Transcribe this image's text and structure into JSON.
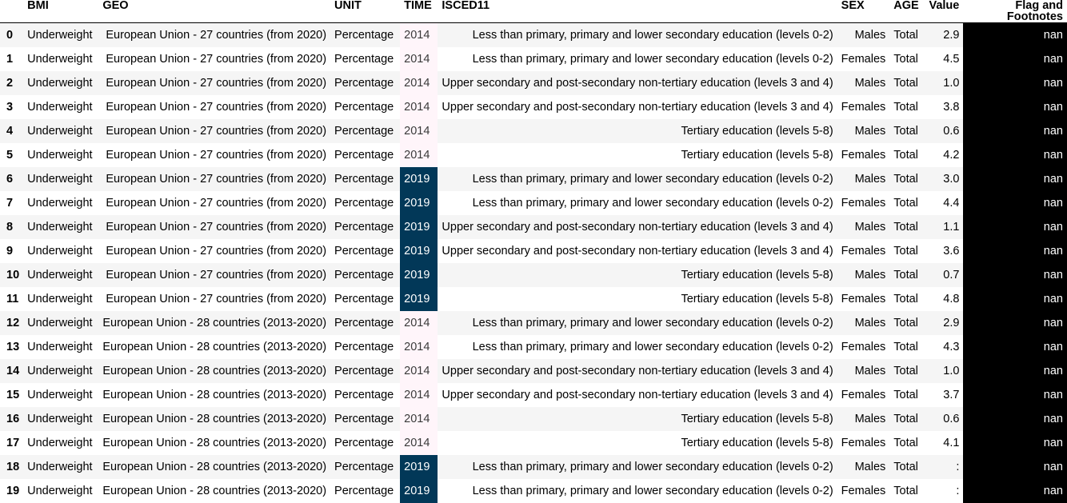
{
  "columns": {
    "index": "",
    "bmi": "BMI",
    "geo": "GEO",
    "unit": "UNIT",
    "time": "TIME",
    "isced": "ISCED11",
    "sex": "SEX",
    "age": "AGE",
    "value": "Value",
    "flag": "Flag and Footnotes"
  },
  "rows": [
    {
      "idx": "0",
      "bmi": "Underweight",
      "geo": "European Union - 27 countries (from 2020)",
      "unit": "Percentage",
      "time": "2014",
      "isced": "Less than primary, primary and lower secondary education (levels 0-2)",
      "sex": "Males",
      "age": "Total",
      "value": "2.9",
      "flag": "nan"
    },
    {
      "idx": "1",
      "bmi": "Underweight",
      "geo": "European Union - 27 countries (from 2020)",
      "unit": "Percentage",
      "time": "2014",
      "isced": "Less than primary, primary and lower secondary education (levels 0-2)",
      "sex": "Females",
      "age": "Total",
      "value": "4.5",
      "flag": "nan"
    },
    {
      "idx": "2",
      "bmi": "Underweight",
      "geo": "European Union - 27 countries (from 2020)",
      "unit": "Percentage",
      "time": "2014",
      "isced": "Upper secondary and post-secondary non-tertiary education (levels 3 and 4)",
      "sex": "Males",
      "age": "Total",
      "value": "1.0",
      "flag": "nan"
    },
    {
      "idx": "3",
      "bmi": "Underweight",
      "geo": "European Union - 27 countries (from 2020)",
      "unit": "Percentage",
      "time": "2014",
      "isced": "Upper secondary and post-secondary non-tertiary education (levels 3 and 4)",
      "sex": "Females",
      "age": "Total",
      "value": "3.8",
      "flag": "nan"
    },
    {
      "idx": "4",
      "bmi": "Underweight",
      "geo": "European Union - 27 countries (from 2020)",
      "unit": "Percentage",
      "time": "2014",
      "isced": "Tertiary education (levels 5-8)",
      "sex": "Males",
      "age": "Total",
      "value": "0.6",
      "flag": "nan"
    },
    {
      "idx": "5",
      "bmi": "Underweight",
      "geo": "European Union - 27 countries (from 2020)",
      "unit": "Percentage",
      "time": "2014",
      "isced": "Tertiary education (levels 5-8)",
      "sex": "Females",
      "age": "Total",
      "value": "4.2",
      "flag": "nan"
    },
    {
      "idx": "6",
      "bmi": "Underweight",
      "geo": "European Union - 27 countries (from 2020)",
      "unit": "Percentage",
      "time": "2019",
      "isced": "Less than primary, primary and lower secondary education (levels 0-2)",
      "sex": "Males",
      "age": "Total",
      "value": "3.0",
      "flag": "nan"
    },
    {
      "idx": "7",
      "bmi": "Underweight",
      "geo": "European Union - 27 countries (from 2020)",
      "unit": "Percentage",
      "time": "2019",
      "isced": "Less than primary, primary and lower secondary education (levels 0-2)",
      "sex": "Females",
      "age": "Total",
      "value": "4.4",
      "flag": "nan"
    },
    {
      "idx": "8",
      "bmi": "Underweight",
      "geo": "European Union - 27 countries (from 2020)",
      "unit": "Percentage",
      "time": "2019",
      "isced": "Upper secondary and post-secondary non-tertiary education (levels 3 and 4)",
      "sex": "Males",
      "age": "Total",
      "value": "1.1",
      "flag": "nan"
    },
    {
      "idx": "9",
      "bmi": "Underweight",
      "geo": "European Union - 27 countries (from 2020)",
      "unit": "Percentage",
      "time": "2019",
      "isced": "Upper secondary and post-secondary non-tertiary education (levels 3 and 4)",
      "sex": "Females",
      "age": "Total",
      "value": "3.6",
      "flag": "nan"
    },
    {
      "idx": "10",
      "bmi": "Underweight",
      "geo": "European Union - 27 countries (from 2020)",
      "unit": "Percentage",
      "time": "2019",
      "isced": "Tertiary education (levels 5-8)",
      "sex": "Males",
      "age": "Total",
      "value": "0.7",
      "flag": "nan"
    },
    {
      "idx": "11",
      "bmi": "Underweight",
      "geo": "European Union - 27 countries (from 2020)",
      "unit": "Percentage",
      "time": "2019",
      "isced": "Tertiary education (levels 5-8)",
      "sex": "Females",
      "age": "Total",
      "value": "4.8",
      "flag": "nan"
    },
    {
      "idx": "12",
      "bmi": "Underweight",
      "geo": "European Union - 28 countries (2013-2020)",
      "unit": "Percentage",
      "time": "2014",
      "isced": "Less than primary, primary and lower secondary education (levels 0-2)",
      "sex": "Males",
      "age": "Total",
      "value": "2.9",
      "flag": "nan"
    },
    {
      "idx": "13",
      "bmi": "Underweight",
      "geo": "European Union - 28 countries (2013-2020)",
      "unit": "Percentage",
      "time": "2014",
      "isced": "Less than primary, primary and lower secondary education (levels 0-2)",
      "sex": "Females",
      "age": "Total",
      "value": "4.3",
      "flag": "nan"
    },
    {
      "idx": "14",
      "bmi": "Underweight",
      "geo": "European Union - 28 countries (2013-2020)",
      "unit": "Percentage",
      "time": "2014",
      "isced": "Upper secondary and post-secondary non-tertiary education (levels 3 and 4)",
      "sex": "Males",
      "age": "Total",
      "value": "1.0",
      "flag": "nan"
    },
    {
      "idx": "15",
      "bmi": "Underweight",
      "geo": "European Union - 28 countries (2013-2020)",
      "unit": "Percentage",
      "time": "2014",
      "isced": "Upper secondary and post-secondary non-tertiary education (levels 3 and 4)",
      "sex": "Females",
      "age": "Total",
      "value": "3.7",
      "flag": "nan"
    },
    {
      "idx": "16",
      "bmi": "Underweight",
      "geo": "European Union - 28 countries (2013-2020)",
      "unit": "Percentage",
      "time": "2014",
      "isced": "Tertiary education (levels 5-8)",
      "sex": "Males",
      "age": "Total",
      "value": "0.6",
      "flag": "nan"
    },
    {
      "idx": "17",
      "bmi": "Underweight",
      "geo": "European Union - 28 countries (2013-2020)",
      "unit": "Percentage",
      "time": "2014",
      "isced": "Tertiary education (levels 5-8)",
      "sex": "Females",
      "age": "Total",
      "value": "4.1",
      "flag": "nan"
    },
    {
      "idx": "18",
      "bmi": "Underweight",
      "geo": "European Union - 28 countries (2013-2020)",
      "unit": "Percentage",
      "time": "2019",
      "isced": "Less than primary, primary and lower secondary education (levels 0-2)",
      "sex": "Males",
      "age": "Total",
      "value": ":",
      "flag": "nan"
    },
    {
      "idx": "19",
      "bmi": "Underweight",
      "geo": "European Union - 28 countries (2013-2020)",
      "unit": "Percentage",
      "time": "2019",
      "isced": "Less than primary, primary and lower secondary education (levels 0-2)",
      "sex": "Females",
      "age": "Total",
      "value": ":",
      "flag": "nan"
    }
  ],
  "colors": {
    "time_2014_bg": "#fff5fa",
    "time_2019_bg": "#023858",
    "flag_bg": "#000000",
    "stripe_bg": "#f5f5f5"
  }
}
